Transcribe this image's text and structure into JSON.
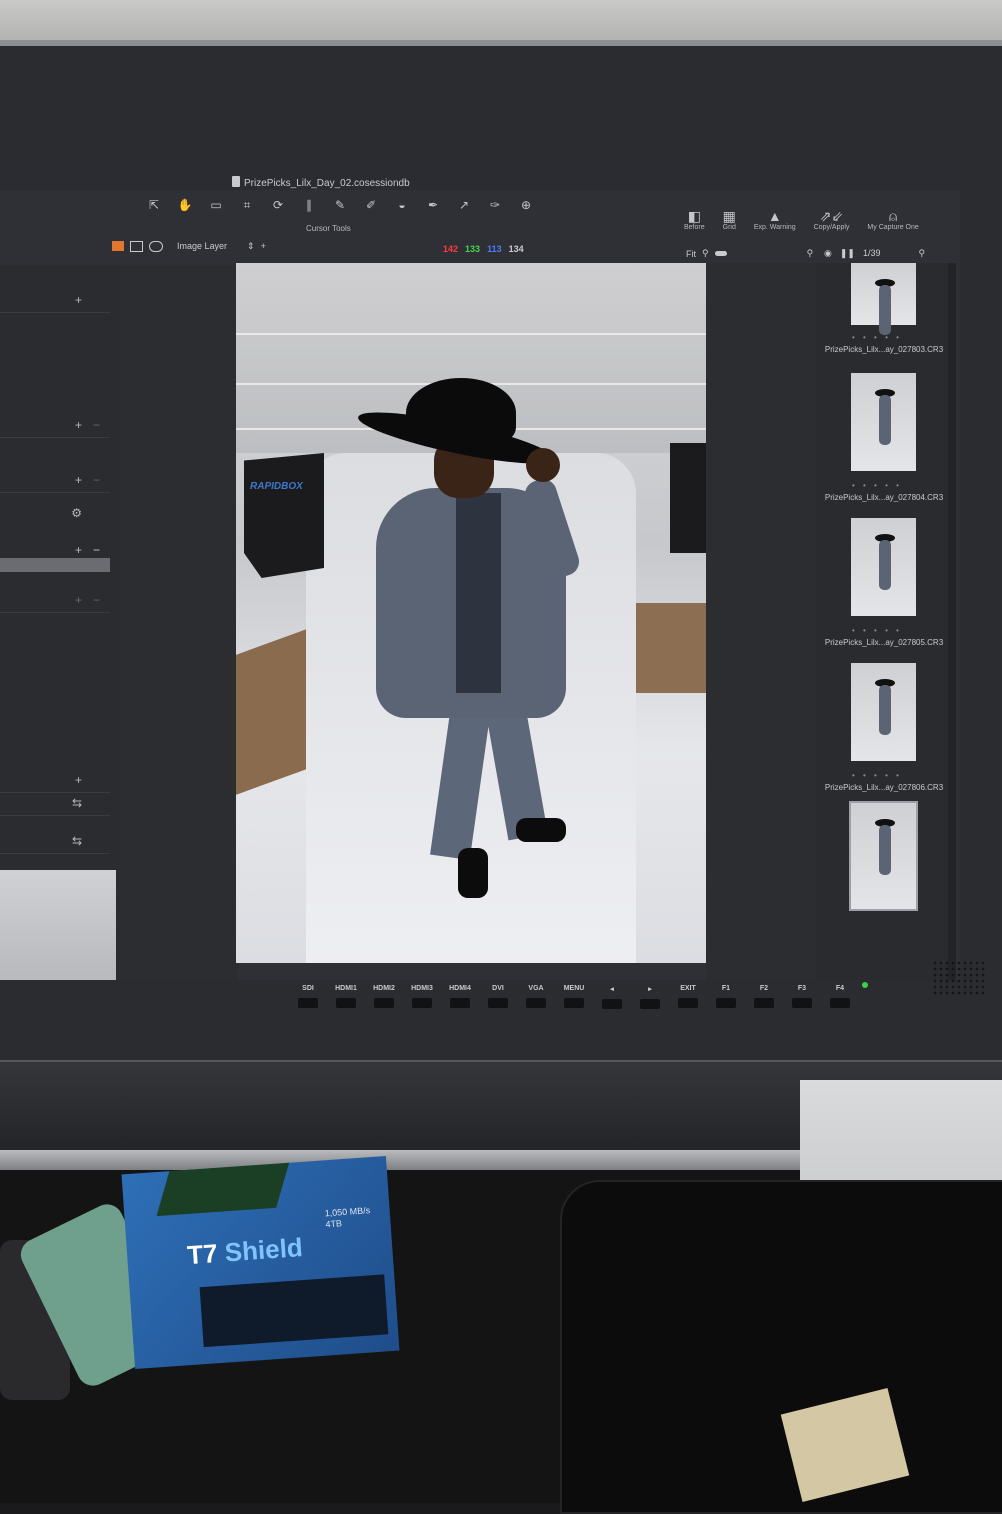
{
  "app": {
    "session_title": "PrizePicks_Lilx_Day_02.cosessiondb",
    "cursor_tools_label": "Cursor Tools",
    "layer_selector": "Image Layer",
    "rgb_readout": {
      "r": "142",
      "g": "133",
      "b": "113",
      "l": "134",
      "colors": {
        "r": "#ff3b3b",
        "g": "#44d44a",
        "b": "#4e7bff",
        "l": "#c9cacf"
      }
    },
    "fit_label": "Fit",
    "counter": "1/39",
    "right_tools": [
      {
        "label": "Before",
        "icon": "before-after-icon"
      },
      {
        "label": "Grid",
        "icon": "grid-icon"
      },
      {
        "label": "Exp. Warning",
        "icon": "warning-icon"
      },
      {
        "label": "Copy/Apply",
        "icon": "copy-apply-icon"
      },
      {
        "label": "My Capture One",
        "icon": "user-icon"
      }
    ]
  },
  "viewer": {
    "softbox_brand": "RAPIDBOX"
  },
  "filmstrip": {
    "items": [
      {
        "name": "PrizePicks_Lilx...ay_027803.CR3",
        "dots": "• • • • •"
      },
      {
        "name": "PrizePicks_Lilx...ay_027804.CR3",
        "dots": "• • • • •"
      },
      {
        "name": "PrizePicks_Lilx...ay_027805.CR3",
        "dots": "• • • • •"
      },
      {
        "name": "PrizePicks_Lilx...ay_027806.CR3",
        "dots": "• • • • •"
      }
    ]
  },
  "monitor": {
    "buttons": [
      "SDI",
      "HDMI1",
      "HDMI2",
      "HDMI3",
      "HDMI4",
      "DVI",
      "VGA",
      "MENU",
      "◂",
      "▸",
      "EXIT",
      "F1",
      "F2",
      "F3",
      "F4"
    ]
  },
  "desk": {
    "ssd_brand": "T7",
    "ssd_model": "Shield",
    "ssd_capacity": "1,050 MB/s\n4TB"
  }
}
